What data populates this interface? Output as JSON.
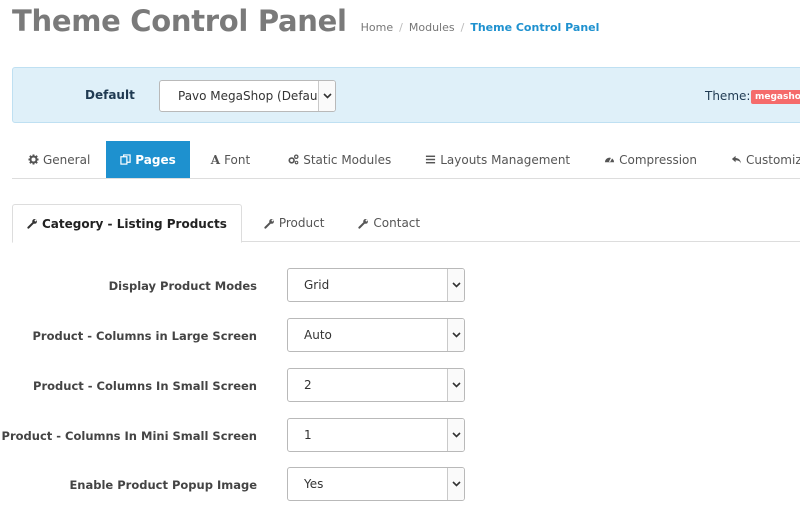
{
  "header": {
    "title": "Theme Control Panel",
    "breadcrumb": [
      "Home",
      "Modules",
      "Theme Control Panel"
    ]
  },
  "theme_bar": {
    "label": "Default",
    "select_value": "Pavo MegaShop (Defau",
    "theme_label": "Theme:",
    "theme_badge": "megashop"
  },
  "main_tabs": [
    {
      "label": "General",
      "icon": "gear-icon"
    },
    {
      "label": "Pages",
      "icon": "copy-icon",
      "active": true
    },
    {
      "label": "Font",
      "icon": "font-icon"
    },
    {
      "label": "Static Modules",
      "icon": "cogs-icon"
    },
    {
      "label": "Layouts Management",
      "icon": "bars-icon"
    },
    {
      "label": "Compression",
      "icon": "dashboard-icon"
    },
    {
      "label": "Customization",
      "icon": "reply-icon"
    }
  ],
  "sub_tabs": [
    {
      "label": "Category - Listing Products",
      "icon": "wrench-icon",
      "active": true
    },
    {
      "label": "Product",
      "icon": "wrench-icon"
    },
    {
      "label": "Contact",
      "icon": "wrench-icon"
    }
  ],
  "form": [
    {
      "label": "Display Product Modes",
      "value": "Grid"
    },
    {
      "label": "Product - Columns in Large Screen",
      "value": "Auto"
    },
    {
      "label": "Product - Columns In Small Screen",
      "value": "2"
    },
    {
      "label": "Product - Columns In Mini Small Screen",
      "value": "1"
    },
    {
      "label": "Enable Product Popup Image",
      "value": "Yes"
    }
  ],
  "colors": {
    "accent": "#1e91cf",
    "info_bg": "#dff0f9",
    "badge": "#f56b6b",
    "title": "#7a7a7a"
  }
}
